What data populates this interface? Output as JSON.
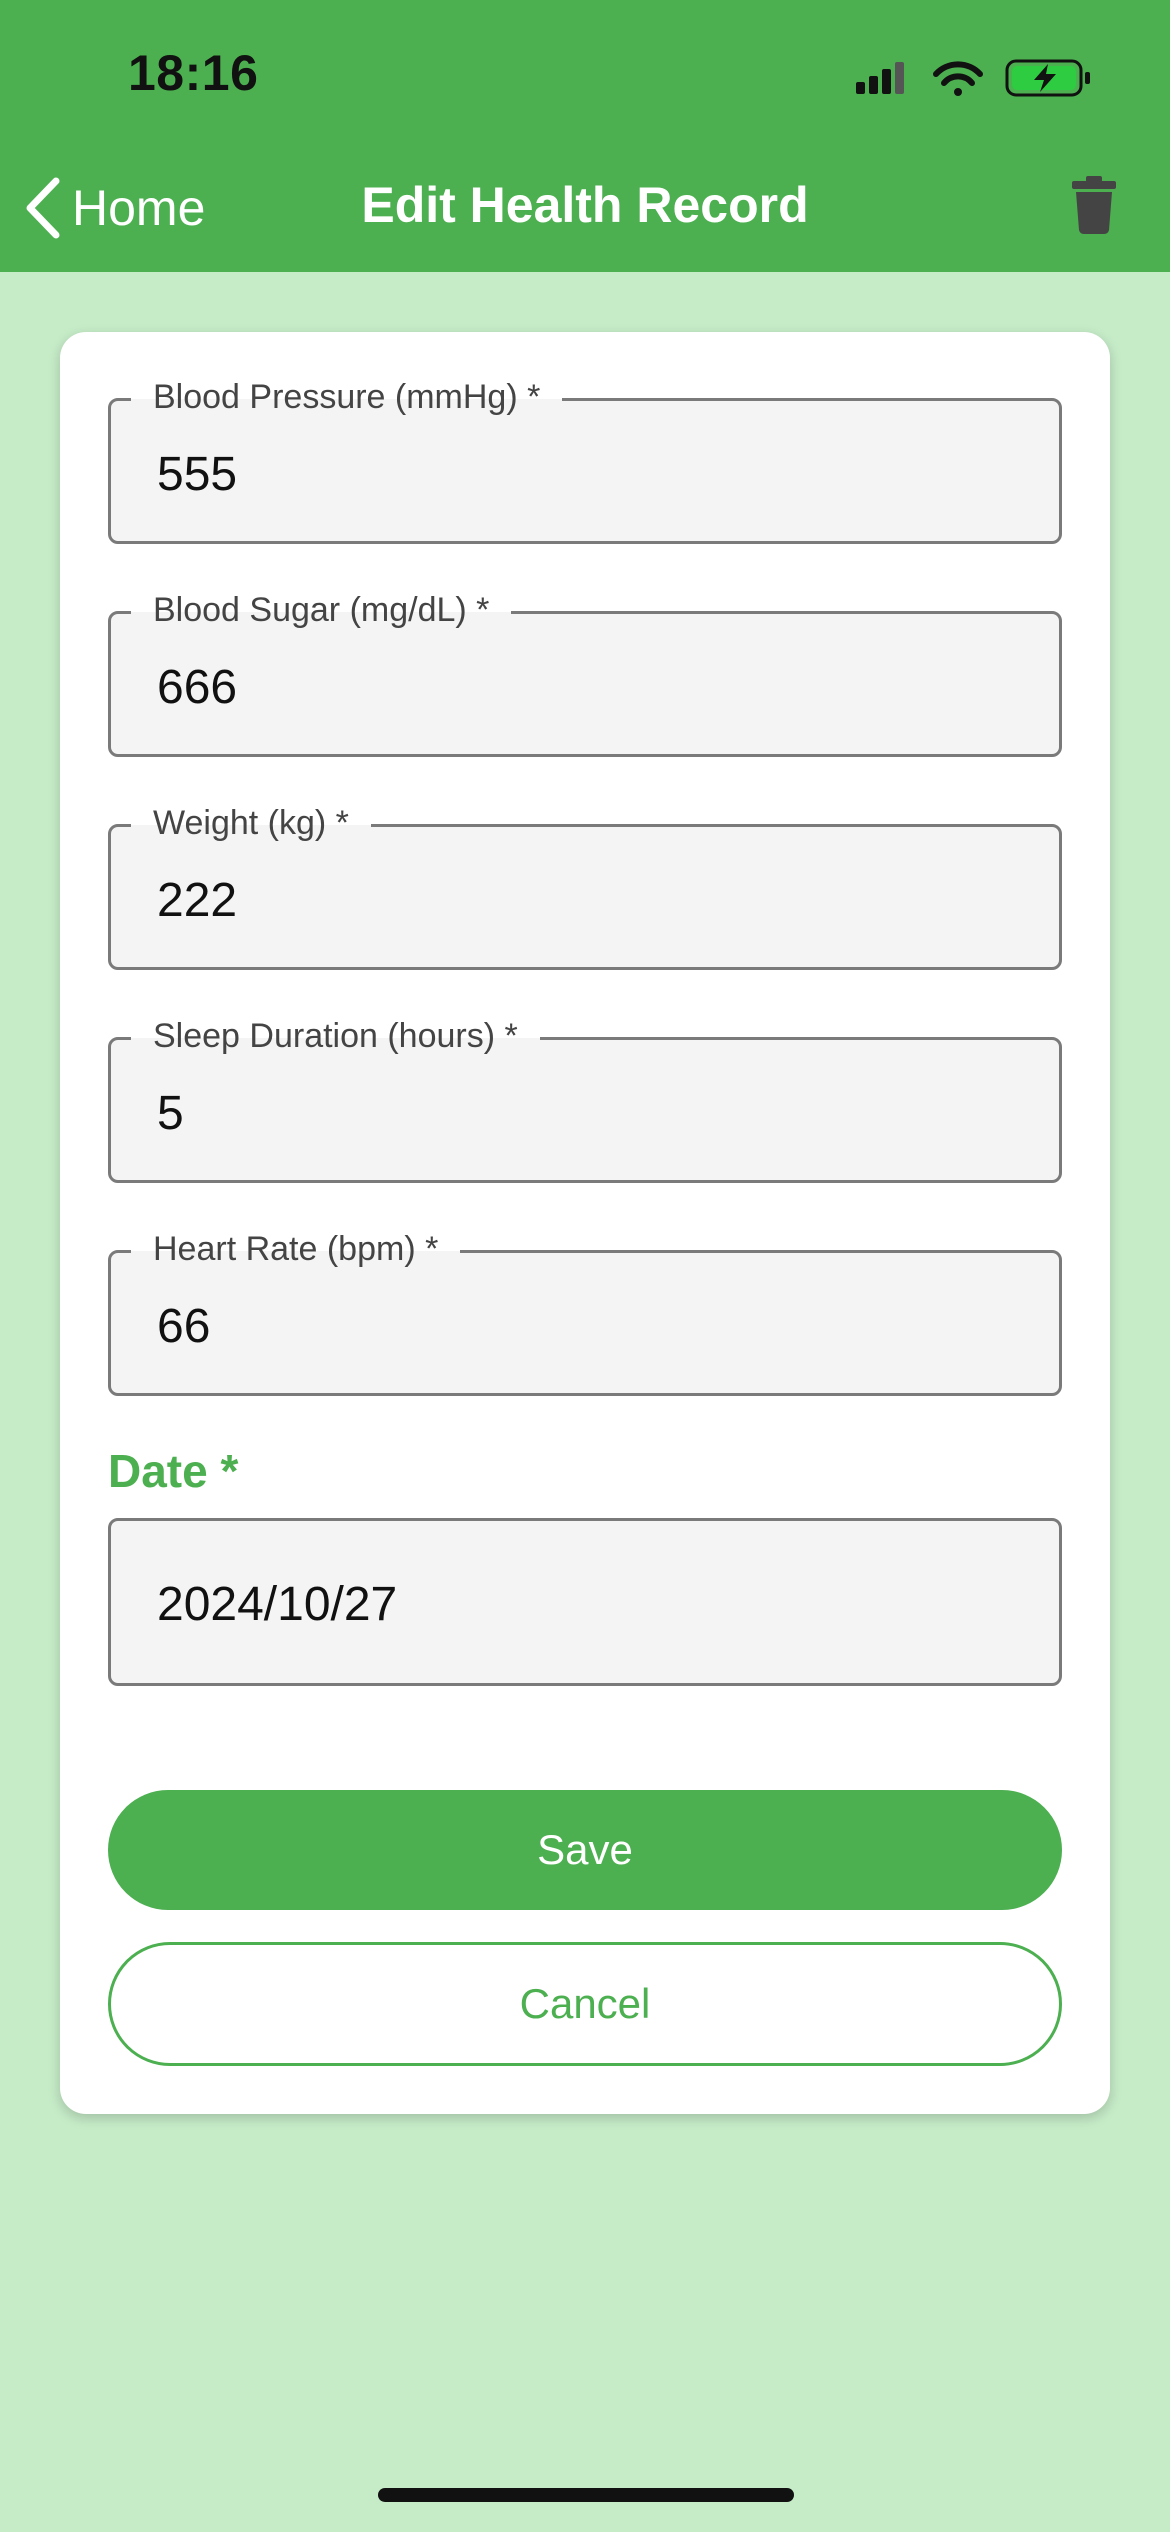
{
  "status_bar": {
    "time": "18:16"
  },
  "nav": {
    "back_label": "Home",
    "title": "Edit Health Record"
  },
  "form": {
    "fields": [
      {
        "label": "Blood Pressure (mmHg) *",
        "value": "555"
      },
      {
        "label": "Blood Sugar (mg/dL) *",
        "value": "666"
      },
      {
        "label": "Weight (kg) *",
        "value": "222"
      },
      {
        "label": "Sleep Duration (hours) *",
        "value": "5"
      },
      {
        "label": "Heart Rate (bpm) *",
        "value": "66"
      }
    ],
    "date_label": "Date *",
    "date_value": "2024/10/27",
    "save_label": "Save",
    "cancel_label": "Cancel"
  },
  "colors": {
    "primary": "#4caf50",
    "background": "#c5ebc7",
    "card": "#ffffff"
  },
  "icons": [
    "chevron-left-icon",
    "trash-icon",
    "signal-icon",
    "wifi-icon",
    "battery-charging-icon"
  ]
}
